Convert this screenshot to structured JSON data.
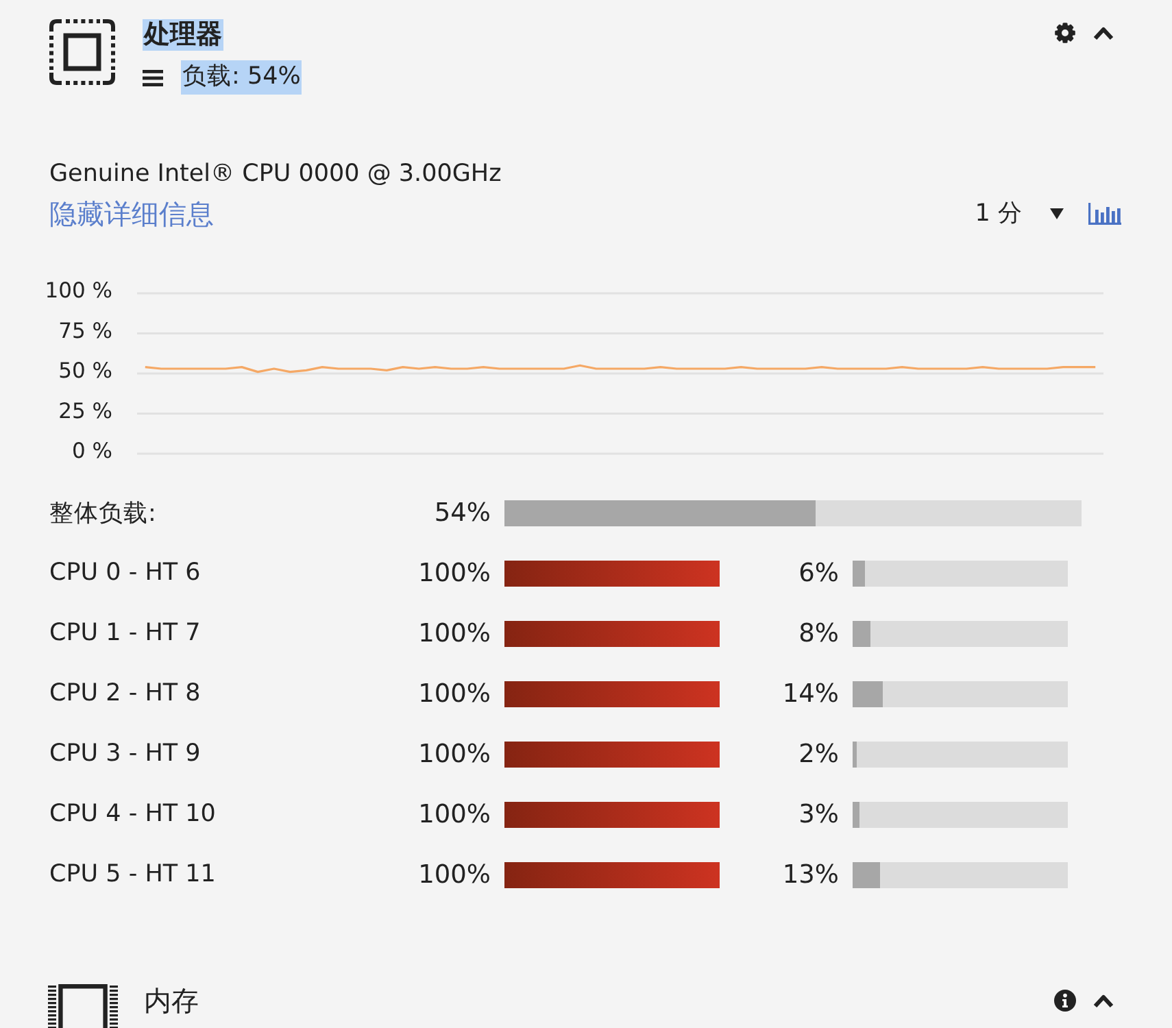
{
  "processor_panel": {
    "title": "处理器",
    "title_highlighted": true,
    "load": "负载: 54%",
    "load_highlighted": true,
    "expanded": true,
    "model": "Genuine Intel® CPU 0000 @ 3.00GHz",
    "details_link": "隐藏详细信息",
    "interval": {
      "value": "1 分"
    },
    "chart_data": {
      "type": "line",
      "ylim": [
        0,
        100
      ],
      "grid": true,
      "yticks": [
        {
          "value": 100,
          "label": "100 %"
        },
        {
          "value": 75,
          "label": "75 %"
        },
        {
          "value": 50,
          "label": "50 %"
        },
        {
          "value": 25,
          "label": "25 %"
        },
        {
          "value": 0,
          "label": "0 %"
        }
      ],
      "series": [
        {
          "color": "#f5a865",
          "values": [
            54,
            53,
            53,
            53,
            53,
            53,
            54,
            51,
            53,
            51,
            52,
            54,
            53,
            53,
            53,
            52,
            54,
            53,
            54,
            53,
            53,
            54,
            53,
            53,
            53,
            53,
            53,
            55,
            53,
            53,
            53,
            53,
            54,
            53,
            53,
            53,
            53,
            54,
            53,
            53,
            53,
            53,
            54,
            53,
            53,
            53,
            53,
            54,
            53,
            53,
            53,
            53,
            54,
            53,
            53,
            53,
            53,
            54,
            54,
            54
          ]
        }
      ]
    },
    "overall": {
      "label": "整体负载:",
      "reading": "54%",
      "level": 0.54
    },
    "cpus": [
      {
        "label": "CPU 0 - HT 6",
        "meters": [
          {
            "reading": "100%",
            "level": 1
          },
          {
            "reading": "6%",
            "level": 0.06
          }
        ]
      },
      {
        "label": "CPU 1 - HT 7",
        "meters": [
          {
            "reading": "100%",
            "level": 1
          },
          {
            "reading": "8%",
            "level": 0.08
          }
        ]
      },
      {
        "label": "CPU 2 - HT 8",
        "meters": [
          {
            "reading": "100%",
            "level": 1
          },
          {
            "reading": "14%",
            "level": 0.14
          }
        ]
      },
      {
        "label": "CPU 3 - HT 9",
        "meters": [
          {
            "reading": "100%",
            "level": 1
          },
          {
            "reading": "2%",
            "level": 0.02
          }
        ]
      },
      {
        "label": "CPU 4 - HT 10",
        "meters": [
          {
            "reading": "100%",
            "level": 1
          },
          {
            "reading": "3%",
            "level": 0.03
          }
        ]
      },
      {
        "label": "CPU 5 - HT 11",
        "meters": [
          {
            "reading": "100%",
            "level": 1
          },
          {
            "reading": "13%",
            "level": 0.13
          }
        ]
      }
    ]
  },
  "memory_panel": {
    "title": "内存",
    "expanded": true
  }
}
